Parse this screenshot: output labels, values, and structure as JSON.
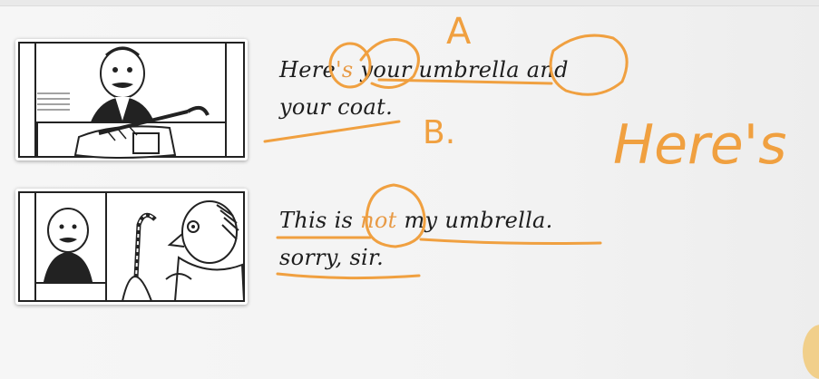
{
  "slide": {
    "lines": [
      {
        "pre": "Here",
        "highlight": "'s",
        "post": " your umbrella and"
      },
      {
        "pre": "your coat.",
        "highlight": "",
        "post": ""
      },
      {
        "pre": "This is ",
        "highlight": "not",
        "post": " my umbrella."
      },
      {
        "pre": "sorry, sir.",
        "highlight": "",
        "post": ""
      }
    ]
  },
  "annotations": {
    "mark_a": "A",
    "mark_b": "B.",
    "handwritten_word": "Here's",
    "color": "#f0a040"
  }
}
